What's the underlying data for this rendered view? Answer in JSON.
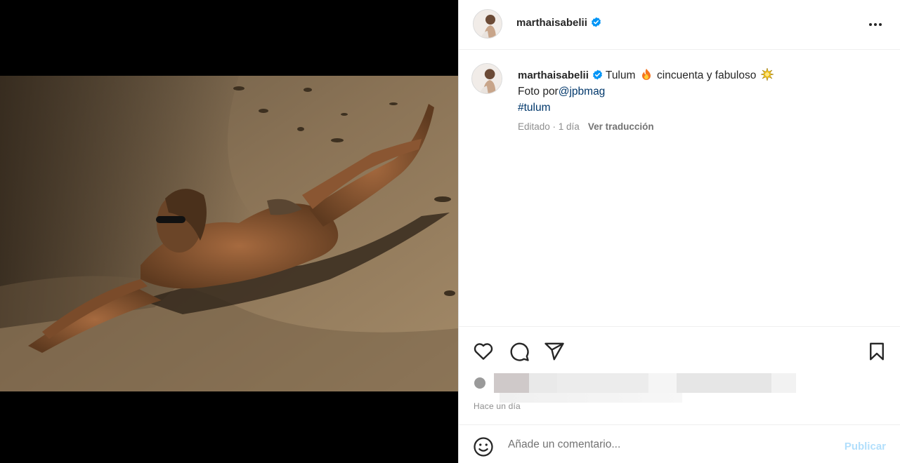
{
  "post": {
    "username": "marthaisabelii",
    "verified": true,
    "more_icon": "more-horizontal-icon"
  },
  "caption": {
    "username": "marthaisabelii",
    "text_1": "Tulum",
    "text_2": "cincuenta y fabuloso",
    "credit_prefix": "Foto por",
    "credit_handle": "@jpbmag",
    "hashtag": "#tulum",
    "emojis": [
      "fire-emoji",
      "sparkle-emoji"
    ]
  },
  "meta": {
    "edited": "Editado · 1 día",
    "translate": "Ver traducción"
  },
  "actions": {
    "icons": [
      "heart-icon",
      "comment-icon",
      "share-icon",
      "bookmark-icon"
    ],
    "timestamp": "Hace un día"
  },
  "comment": {
    "placeholder": "Añade un comentario...",
    "publish_label": "Publicar",
    "emoji_icon": "smile-icon"
  },
  "colors": {
    "verified_blue": "#0095f6",
    "link": "#00376b",
    "publish_disabled": "#b2dffc"
  }
}
